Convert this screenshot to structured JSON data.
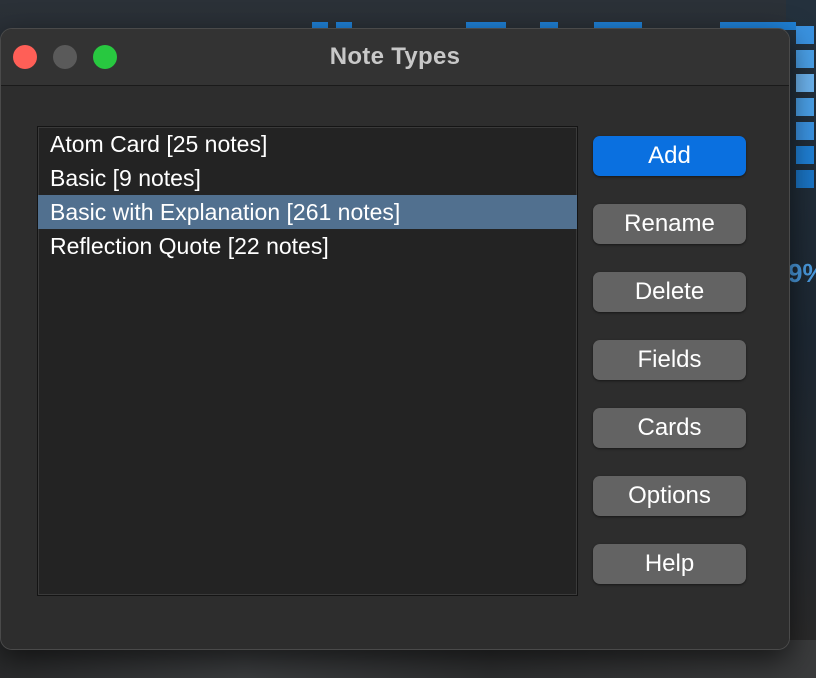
{
  "window": {
    "title": "Note Types"
  },
  "note_types": [
    {
      "label": "Atom Card [25 notes]",
      "selected": false
    },
    {
      "label": "Basic [9 notes]",
      "selected": false
    },
    {
      "label": "Basic with Explanation [261 notes]",
      "selected": true
    },
    {
      "label": "Reflection Quote [22 notes]",
      "selected": false
    }
  ],
  "buttons": {
    "add": "Add",
    "rename": "Rename",
    "delete": "Delete",
    "fields": "Fields",
    "cards": "Cards",
    "options": "Options",
    "help": "Help"
  },
  "background": {
    "percent_fragment": "9%"
  },
  "colors": {
    "accent": "#0a70e0",
    "selection": "#51708f",
    "close": "#ff5f57",
    "zoom": "#28c840"
  }
}
